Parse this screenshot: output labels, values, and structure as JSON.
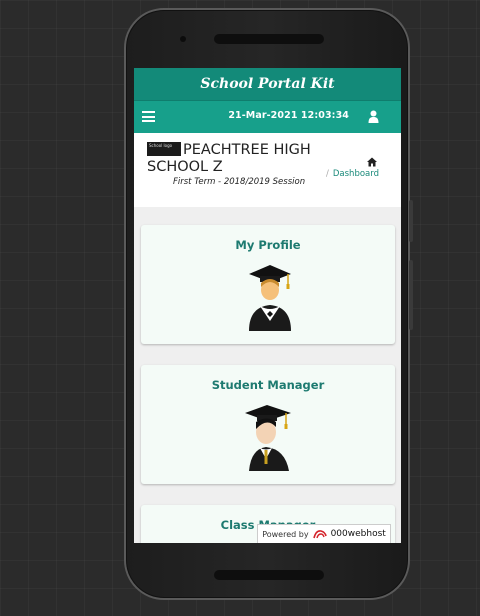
{
  "app": {
    "brand_title": "School Portal Kit",
    "datetime": "21-Mar-2021 12:03:34"
  },
  "header": {
    "logo_text": "School logo",
    "school_name": "PEACHTREE HIGH SCHOOL Z",
    "term": "First Term - 2018/2019 Session",
    "breadcrumb": "Dashboard",
    "breadcrumb_sep": "/"
  },
  "cards": [
    {
      "label": "My Profile",
      "icon": "graduate-icon"
    },
    {
      "label": "Student Manager",
      "icon": "student-icon"
    },
    {
      "label": "Class Manager",
      "icon": "class-icon"
    }
  ],
  "footer": {
    "powered_by": "Powered by",
    "host": "000webhost"
  },
  "colors": {
    "brand_bar": "#138a79",
    "nav_bar": "#17a08b",
    "card_title": "#1d7a70",
    "card_bg": "#f4fbf7"
  }
}
